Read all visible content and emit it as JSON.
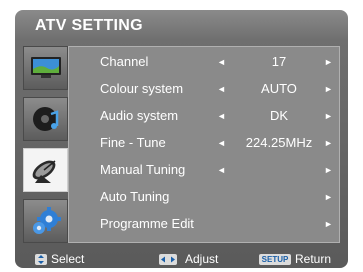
{
  "title": "ATV SETTING",
  "sidebar": [
    {
      "icon": "tv-icon"
    },
    {
      "icon": "audio-disc-icon"
    },
    {
      "icon": "satellite-dish-icon",
      "active": true
    },
    {
      "icon": "gears-icon"
    }
  ],
  "rows": [
    {
      "label": "Channel",
      "value": "17",
      "left_arrow": "◄",
      "right_arrow": "►"
    },
    {
      "label": "Colour system",
      "value": "AUTO",
      "left_arrow": "◄",
      "right_arrow": "►"
    },
    {
      "label": "Audio system",
      "value": "DK",
      "left_arrow": "◄",
      "right_arrow": "►"
    },
    {
      "label": "Fine - Tune",
      "value": "224.25MHz",
      "left_arrow": "◄",
      "right_arrow": "►"
    },
    {
      "label": "Manual Tuning",
      "value": "",
      "left_arrow": "◄",
      "right_arrow": "►"
    },
    {
      "label": "Auto Tuning",
      "value": "",
      "left_arrow": "",
      "right_arrow": "►"
    },
    {
      "label": "Programme Edit",
      "value": "",
      "left_arrow": "",
      "right_arrow": "►"
    }
  ],
  "footer": {
    "select_label": "Select",
    "adjust_label": "Adjust",
    "setup_key": "SETUP",
    "return_label": "Return"
  }
}
